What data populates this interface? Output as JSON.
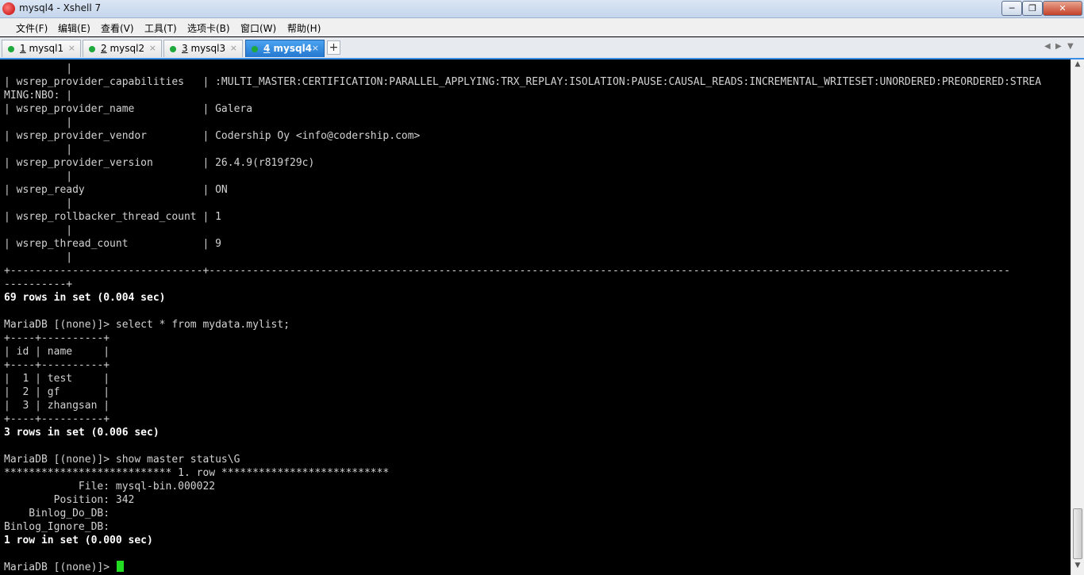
{
  "window": {
    "title": "mysql4 - Xshell 7"
  },
  "window_controls": {
    "minimize": "─",
    "maximize": "❐",
    "close": "✕"
  },
  "menu": [
    "文件(F)",
    "编辑(E)",
    "查看(V)",
    "工具(T)",
    "选项卡(B)",
    "窗口(W)",
    "帮助(H)"
  ],
  "tabs": [
    {
      "number": "1",
      "name": "mysql1",
      "active": false
    },
    {
      "number": "2",
      "name": "mysql2",
      "active": false
    },
    {
      "number": "3",
      "name": "mysql3",
      "active": false
    },
    {
      "number": "4",
      "name": "mysql4",
      "active": true
    }
  ],
  "tab_close_glyph": "×",
  "tab_add_glyph": "+",
  "tab_nav": {
    "prev": "◀",
    "next": "▶",
    "menu": "▼"
  },
  "colors": {
    "accent": "#2478d0",
    "status_dot": "#1fa83b",
    "cursor": "#22dd22"
  },
  "terminal": {
    "lines": [
      {
        "text": "          |",
        "bold": false
      },
      {
        "text": "| wsrep_provider_capabilities   | :MULTI_MASTER:CERTIFICATION:PARALLEL_APPLYING:TRX_REPLAY:ISOLATION:PAUSE:CAUSAL_READS:INCREMENTAL_WRITESET:UNORDERED:PREORDERED:STREA",
        "bold": false
      },
      {
        "text": "MING:NBO: |",
        "bold": false
      },
      {
        "text": "| wsrep_provider_name           | Galera",
        "bold": false
      },
      {
        "text": "          |",
        "bold": false
      },
      {
        "text": "| wsrep_provider_vendor         | Codership Oy <info@codership.com>",
        "bold": false
      },
      {
        "text": "          |",
        "bold": false
      },
      {
        "text": "| wsrep_provider_version        | 26.4.9(r819f29c)",
        "bold": false
      },
      {
        "text": "          |",
        "bold": false
      },
      {
        "text": "| wsrep_ready                   | ON",
        "bold": false
      },
      {
        "text": "          |",
        "bold": false
      },
      {
        "text": "| wsrep_rollbacker_thread_count | 1",
        "bold": false
      },
      {
        "text": "          |",
        "bold": false
      },
      {
        "text": "| wsrep_thread_count            | 9",
        "bold": false
      },
      {
        "text": "          |",
        "bold": false
      },
      {
        "text": "+-------------------------------+---------------------------------------------------------------------------------------------------------------------------------",
        "bold": false
      },
      {
        "text": "----------+",
        "bold": false
      },
      {
        "text": "69 rows in set (0.004 sec)",
        "bold": true
      },
      {
        "text": "",
        "bold": false
      },
      {
        "text": "MariaDB [(none)]> select * from mydata.mylist;",
        "bold": false
      },
      {
        "text": "+----+----------+",
        "bold": false
      },
      {
        "text": "| id | name     |",
        "bold": false
      },
      {
        "text": "+----+----------+",
        "bold": false
      },
      {
        "text": "|  1 | test     |",
        "bold": false
      },
      {
        "text": "|  2 | gf       |",
        "bold": false
      },
      {
        "text": "|  3 | zhangsan |",
        "bold": false
      },
      {
        "text": "+----+----------+",
        "bold": false
      },
      {
        "text": "3 rows in set (0.006 sec)",
        "bold": true
      },
      {
        "text": "",
        "bold": false
      },
      {
        "text": "MariaDB [(none)]> show master status\\G",
        "bold": false
      },
      {
        "text": "*************************** 1. row ***************************",
        "bold": false
      },
      {
        "text": "            File: mysql-bin.000022",
        "bold": false
      },
      {
        "text": "        Position: 342",
        "bold": false
      },
      {
        "text": "    Binlog_Do_DB: ",
        "bold": false
      },
      {
        "text": "Binlog_Ignore_DB: ",
        "bold": false
      },
      {
        "text": "1 row in set (0.000 sec)",
        "bold": true
      },
      {
        "text": "",
        "bold": false
      },
      {
        "text": "MariaDB [(none)]> ",
        "bold": false,
        "cursor": true
      }
    ]
  },
  "scrollbar": {
    "up": "▲",
    "down": "▼"
  }
}
